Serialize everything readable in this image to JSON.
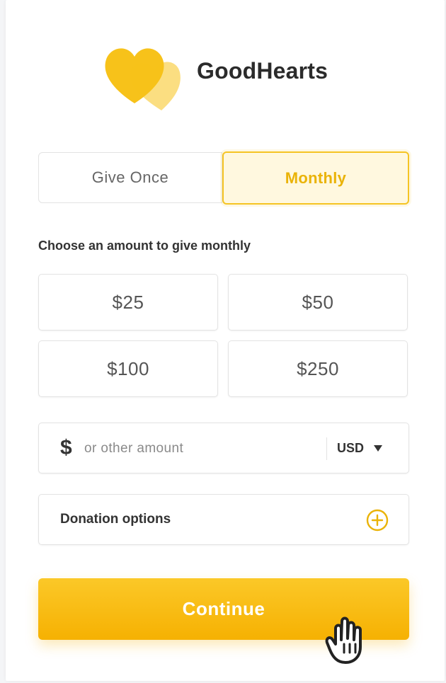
{
  "brand": {
    "name": "GoodHearts",
    "logo": "two-hearts-logo"
  },
  "frequency": {
    "options": [
      {
        "label": "Give Once",
        "selected": false
      },
      {
        "label": "Monthly",
        "selected": true
      }
    ]
  },
  "prompt": "Choose an amount to give monthly",
  "amounts": [
    "$25",
    "$50",
    "$100",
    "$250"
  ],
  "other_amount": {
    "icon": "dollar-icon",
    "symbol": "$",
    "placeholder": "or other amount",
    "value": ""
  },
  "currency": {
    "selected": "USD",
    "icon": "caret-down-icon"
  },
  "donation_options": {
    "label": "Donation options",
    "icon": "plus-circle-icon"
  },
  "continue": {
    "label": "Continue"
  },
  "colors": {
    "accent": "#F6B102",
    "accent_light": "#FFF8DF",
    "text": "#333333"
  },
  "cursor": "hand-pointer-icon"
}
